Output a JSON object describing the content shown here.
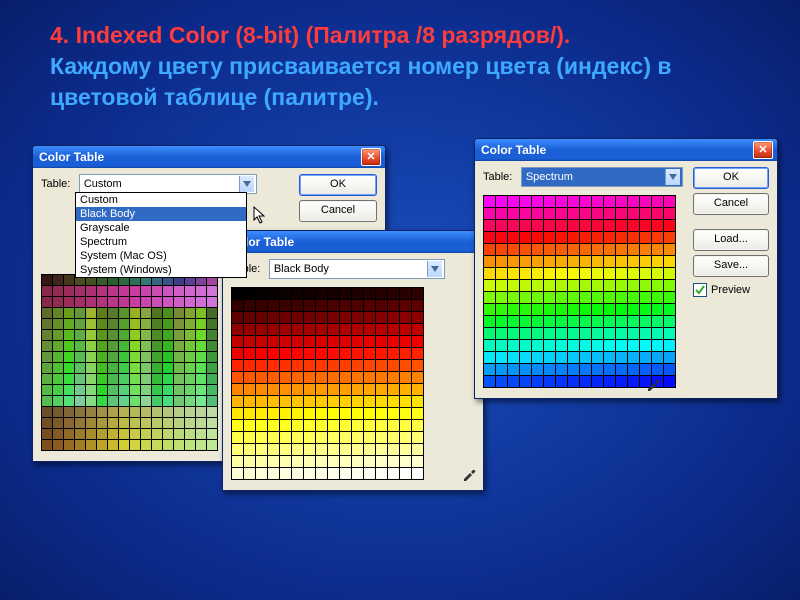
{
  "heading": {
    "line1": "4.      Indexed Color (8-bit) (Палитра /8 разрядов/).",
    "line2": "Каждому цвету присваивается номер цвета (индекс) в цветовой таблице (палитре)."
  },
  "dlg": {
    "title": "Color Table",
    "table_label": "Table:",
    "ok": "OK",
    "cancel": "Cancel",
    "load": "Load...",
    "save": "Save...",
    "preview": "Preview"
  },
  "d1": {
    "combo_value": "Custom",
    "options": [
      "Custom",
      "Black Body",
      "Grayscale",
      "Spectrum",
      "System (Mac OS)",
      "System (Windows)"
    ],
    "highlight_index": 1
  },
  "d2": {
    "combo_value": "Black Body"
  },
  "d3": {
    "combo_value": "Spectrum"
  }
}
